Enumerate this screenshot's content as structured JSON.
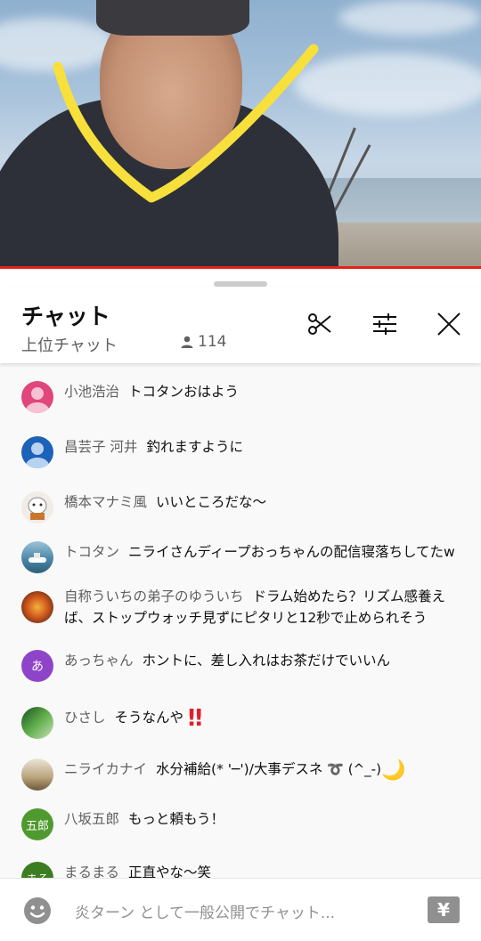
{
  "chat": {
    "title": "チャット",
    "mode": "上位チャット",
    "viewer_count": "114"
  },
  "messages": [
    {
      "author": "小池浩治",
      "text": "トコタンおはよう",
      "avatar": {
        "type": "default",
        "color": "#e0457b"
      }
    },
    {
      "author": "昌芸子 河井",
      "text": "釣れますように",
      "avatar": {
        "type": "default",
        "color": "#1c62b9"
      }
    },
    {
      "author": "橋本マナミ風",
      "text": "いいところだな〜",
      "avatar": {
        "type": "image",
        "color": "#f1ece6"
      }
    },
    {
      "author": "トコタン",
      "text": "ニライさんディープおっちゃんの配信寝落ちしてたw",
      "avatar": {
        "type": "image",
        "color": "#4c87a8"
      }
    },
    {
      "author": "自称ういちの弟子のゆういち",
      "text": "ドラム始めたら？リズム感養えば、ストップウォッチ見ずにピタリと12秒で止められそう",
      "avatar": {
        "type": "image",
        "color": "#a2431c"
      }
    },
    {
      "author": "あっちゃん",
      "text": "ホントに、差し入れはお茶だけでいいん",
      "avatar": {
        "type": "letter",
        "letter": "あ",
        "color": "#8e44c9"
      }
    },
    {
      "author": "ひさし",
      "text": "そうなんや",
      "emoji": "‼",
      "avatar": {
        "type": "image",
        "color": "#3f8a3c"
      }
    },
    {
      "author": "ニライカナイ",
      "text": "水分補給(* '─')/大事デスネ",
      "emoji_after": "➰ (^_-)",
      "moon": "🌙",
      "avatar": {
        "type": "image",
        "color": "#b8a27a"
      }
    },
    {
      "author": "八坂五郎",
      "text": "もっと頼もう！",
      "avatar": {
        "type": "letter",
        "letter": "五郎",
        "color": "#4f9a2e"
      }
    },
    {
      "author": "まるまる",
      "text": "正直やな〜笑",
      "avatar": {
        "type": "letter",
        "letter": "まる",
        "color": "#3c7d22"
      }
    }
  ],
  "input": {
    "placeholder": "炎ターン として一般公開でチャット..."
  },
  "icons": {
    "clip": "scissors-icon",
    "filter": "sliders-icon",
    "close": "close-icon",
    "viewers": "person-icon",
    "emoji": "smiley-icon",
    "super_chat": "yen-icon"
  },
  "colors": {
    "accent_red": "#e62117",
    "drawing_yellow": "#f7e03c"
  }
}
